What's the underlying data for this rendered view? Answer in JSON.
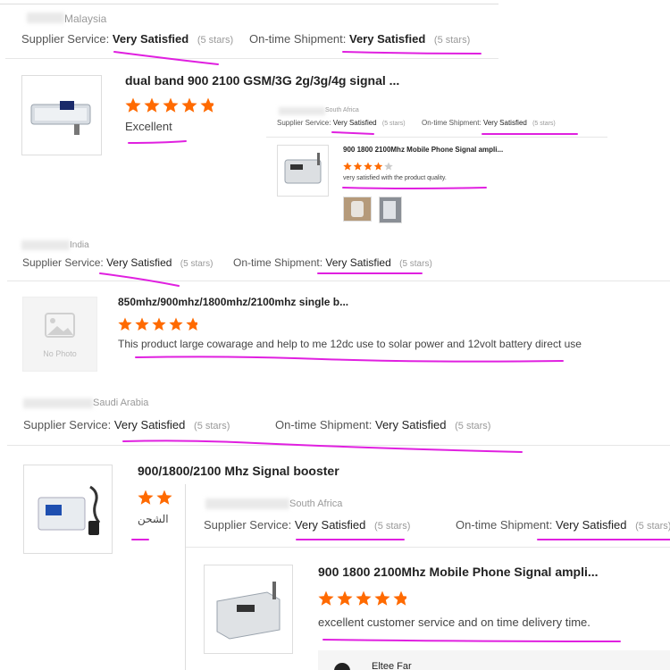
{
  "card1": {
    "country": "Malaysia",
    "supplier_label": "Supplier Service:",
    "supplier_value": "Very Satisfied",
    "supplier_stars": "(5 stars)",
    "shipment_label": "On-time Shipment:",
    "shipment_value": "Very Satisfied",
    "shipment_stars": "(5 stars)",
    "product_title": "dual band 900 2100 GSM/3G 2g/3g/4g signal ...",
    "rating": 5,
    "review": "Excellent"
  },
  "card2": {
    "country": "South Africa",
    "supplier_label": "Supplier Service:",
    "supplier_value": "Very Satisfied",
    "supplier_stars": "(5 stars)",
    "shipment_label": "On-time Shipment:",
    "shipment_value": "Very Satisfied",
    "shipment_stars": "(5 stars)",
    "product_title": "900 1800 2100Mhz Mobile Phone Signal ampli...",
    "rating": 4,
    "review": "very satisfied with the product quality."
  },
  "card3": {
    "country": "India",
    "supplier_label": "Supplier Service:",
    "supplier_value": "Very Satisfied",
    "supplier_stars": "(5 stars)",
    "shipment_label": "On-time Shipment:",
    "shipment_value": "Very Satisfied",
    "shipment_stars": "(5 stars)",
    "product_title": "850mhz/900mhz/1800mhz/2100mhz single b...",
    "no_photo": "No Photo",
    "rating": 5,
    "review": "This product large cowarage and help to me 12dc use to solar power and 12volt battery direct use"
  },
  "card4": {
    "country": "Saudi Arabia",
    "supplier_label": "Supplier Service:",
    "supplier_value": "Very Satisfied",
    "supplier_stars": "(5 stars)",
    "shipment_label": "On-time Shipment:",
    "shipment_value": "Very Satisfied",
    "shipment_stars": "(5 stars)",
    "product_title": "900/1800/2100 Mhz Signal booster",
    "rating": 2,
    "review": "الشحن"
  },
  "card5": {
    "country": "South Africa",
    "supplier_label": "Supplier Service:",
    "supplier_value": "Very Satisfied",
    "supplier_stars": "(5 stars)",
    "shipment_label": "On-time Shipment:",
    "shipment_value": "Very Satisfied",
    "shipment_stars": "(5 stars)",
    "product_title": "900 1800 2100Mhz Mobile Phone Signal ampli...",
    "rating": 5,
    "review": "excellent customer service and on time delivery time.",
    "footer_text": "Eltee Far"
  },
  "colors": {
    "star": "#ff6a00",
    "star_empty": "#cccccc",
    "highlight": "#e020e0"
  },
  "icons": {
    "star": "star-icon",
    "no_photo": "image-placeholder-icon"
  }
}
